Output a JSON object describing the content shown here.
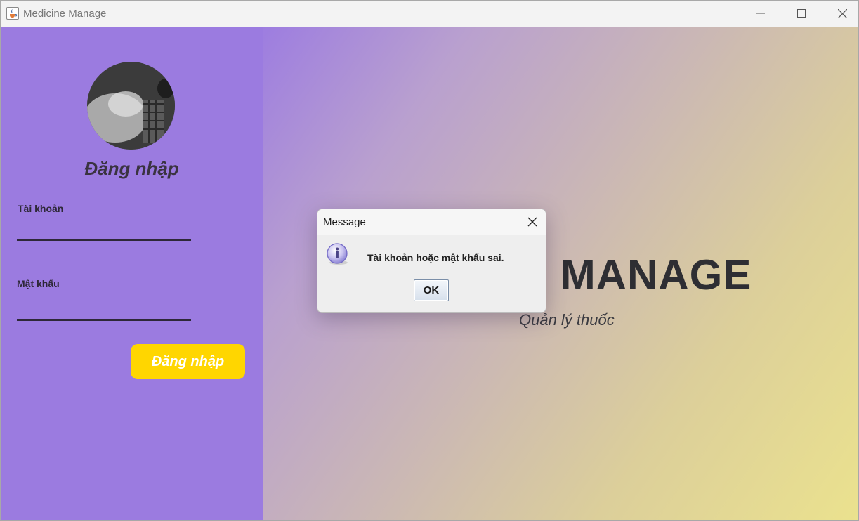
{
  "window": {
    "title": "Medicine Manage",
    "icon": "java-cup-icon"
  },
  "login": {
    "heading": "Đăng nhập",
    "username_label": "Tài khoản",
    "username_value": "",
    "password_label": "Mật khẩu",
    "password_value": "",
    "submit_label": "Đăng nhập"
  },
  "branding": {
    "title_visible": "E MANAGE",
    "subtitle": "Quản lý thuốc"
  },
  "dialog": {
    "title": "Message",
    "message": "Tài khoản hoặc mật khẩu sai.",
    "ok_label": "OK",
    "icon": "info-icon"
  },
  "colors": {
    "left_panel": "#9b7be0",
    "login_button": "#ffd600",
    "gradient_start": "#9d7de0",
    "gradient_end": "#ebe28e"
  }
}
